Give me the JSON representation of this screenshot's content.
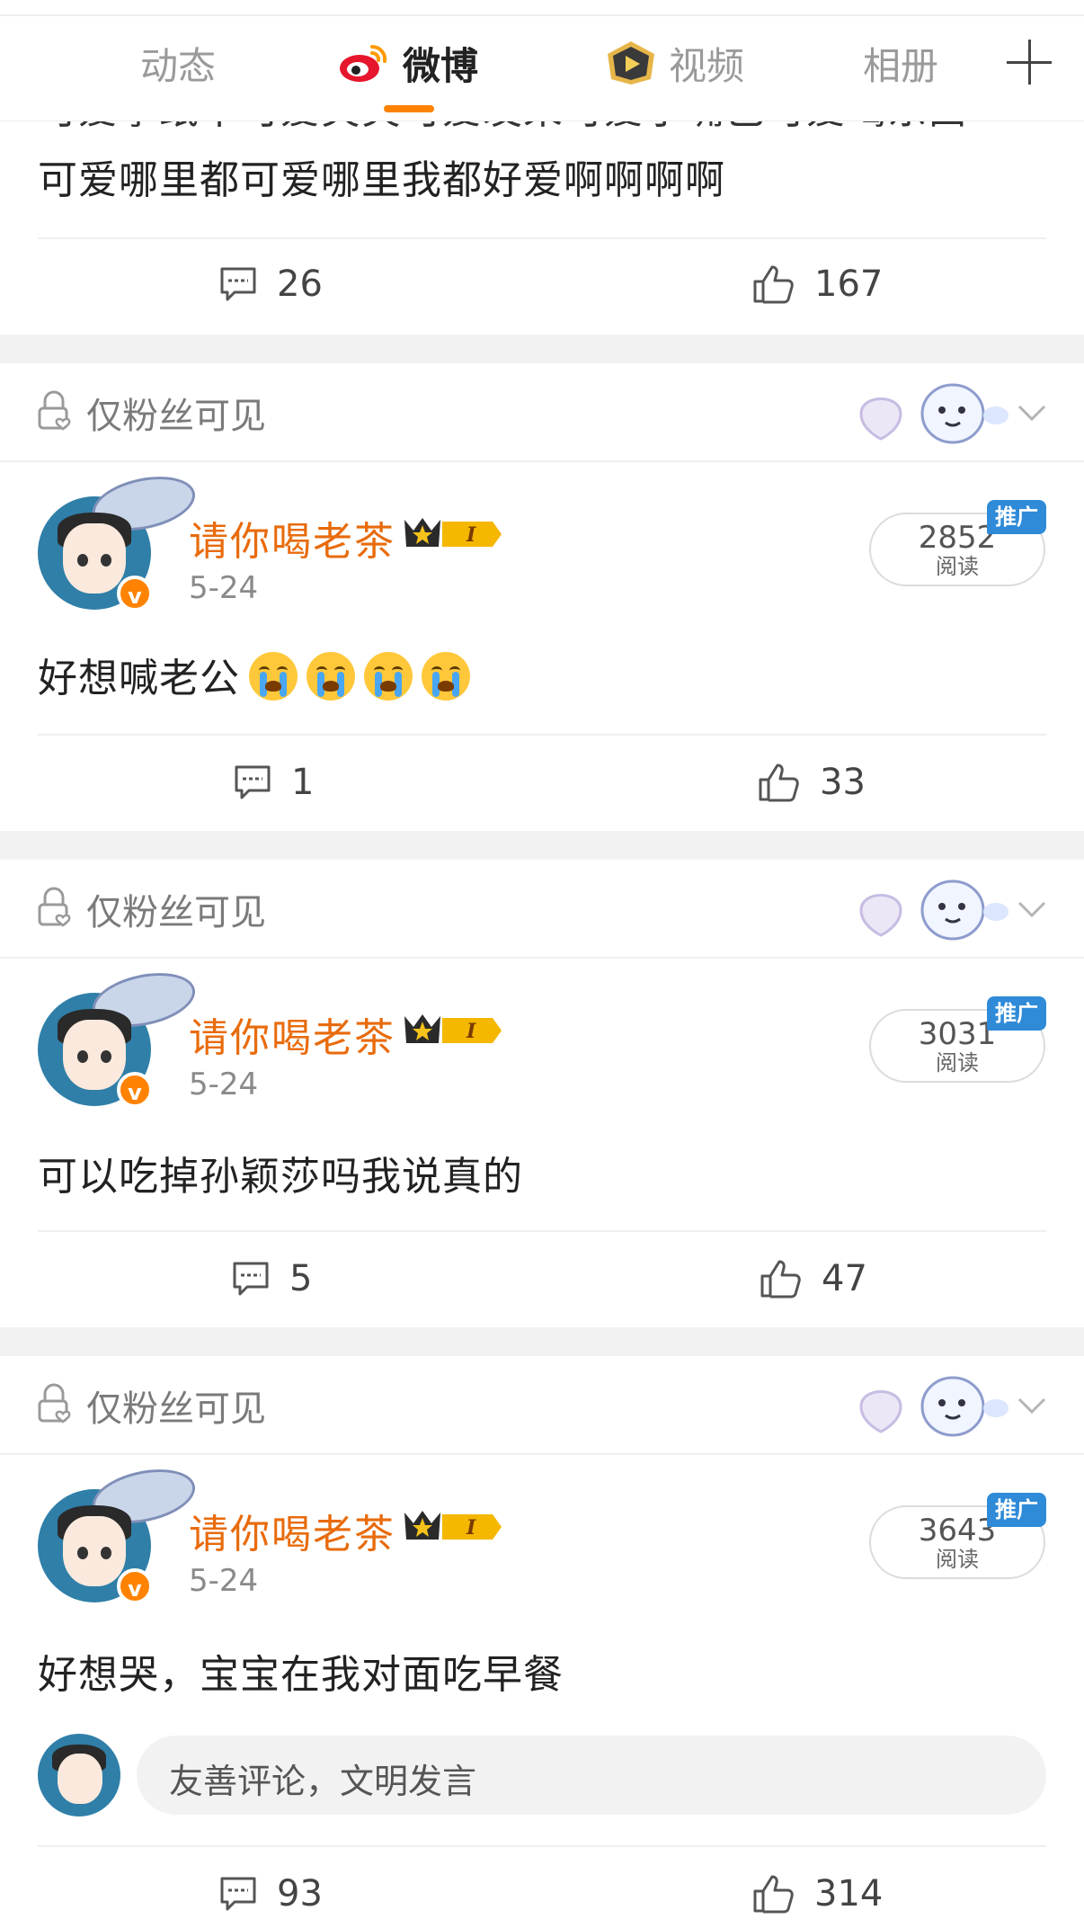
{
  "header": {
    "tabs": [
      {
        "label": "动态",
        "icon": "none"
      },
      {
        "label": "微博",
        "icon": "weibo-logo-icon",
        "active": true
      },
      {
        "label": "视频",
        "icon": "video-play-icon"
      },
      {
        "label": "相册",
        "icon": "none"
      }
    ],
    "add_icon": "plus-icon",
    "accent_color": "#ff8200"
  },
  "partial_post": {
    "text_line_cut": "可爱拿纸巾可爱笑笑可爱发呆可爱小嘴巴可爱喝东西",
    "text_line": "可爱哪里都可爱哪里我都好爱啊啊啊啊",
    "comments": "26",
    "likes": "167"
  },
  "posts": [
    {
      "visibility": "仅粉丝可见",
      "username": "请你喝老茶",
      "level_badge": "I",
      "date": "5-24",
      "read_count": "2852",
      "read_label": "阅读",
      "promo_tag": "推广",
      "text": "好想喊老公",
      "emoji_count": 4,
      "comments": "1",
      "likes": "33"
    },
    {
      "visibility": "仅粉丝可见",
      "username": "请你喝老茶",
      "level_badge": "I",
      "date": "5-24",
      "read_count": "3031",
      "read_label": "阅读",
      "promo_tag": "推广",
      "text": "可以吃掉孙颖莎吗我说真的",
      "comments": "5",
      "likes": "47"
    },
    {
      "visibility": "仅粉丝可见",
      "username": "请你喝老茶",
      "level_badge": "I",
      "date": "5-24",
      "read_count": "3643",
      "read_label": "阅读",
      "promo_tag": "推广",
      "text": "好想哭，宝宝在我对面吃早餐",
      "comment_placeholder": "友善评论，文明发言",
      "comments": "93",
      "likes": "314"
    }
  ],
  "colors": {
    "username": "#e86b0c",
    "promo": "#2f8bd8",
    "verified": "#ff8200",
    "separator": "#f2f2f2"
  }
}
